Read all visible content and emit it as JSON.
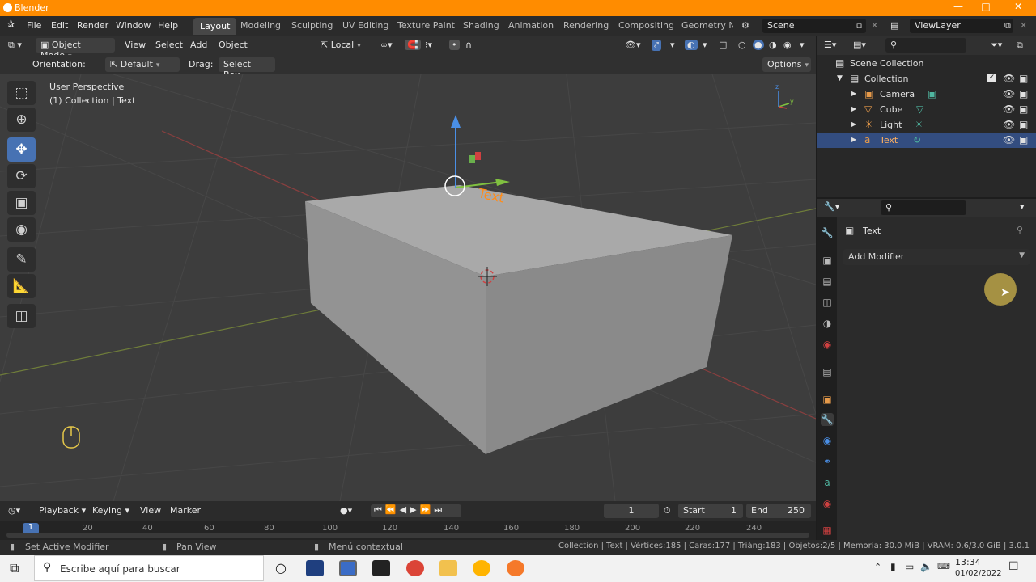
{
  "window": {
    "title": "Blender",
    "min_icon": "minimize-icon",
    "max_icon": "maximize-icon",
    "close_icon": "close-icon"
  },
  "menu": [
    "File",
    "Edit",
    "Render",
    "Window",
    "Help"
  ],
  "workspaces": [
    "Layout",
    "Modeling",
    "Sculpting",
    "UV Editing",
    "Texture Paint",
    "Shading",
    "Animation",
    "Rendering",
    "Compositing",
    "Geometry Nc"
  ],
  "scene": {
    "name": "Scene",
    "view_layer": "ViewLayer"
  },
  "viewport_header": {
    "mode": "Object Mode",
    "menus": [
      "View",
      "Select",
      "Add",
      "Object"
    ],
    "transform_orientation": "Local",
    "orientation_label": "Orientation:",
    "orientation_value": "Default",
    "drag_label": "Drag:",
    "drag_value": "Select Box",
    "options": "Options"
  },
  "viewport": {
    "perspective": "User Perspective",
    "context": "(1) Collection | Text"
  },
  "outliner": {
    "scene_collection": "Scene Collection",
    "collection": "Collection",
    "items": [
      {
        "label": "Camera",
        "icon": "camera-icon",
        "color": "#e69a4a"
      },
      {
        "label": "Cube",
        "icon": "mesh-icon",
        "color": "#e69a4a"
      },
      {
        "label": "Light",
        "icon": "light-icon",
        "color": "#e69a4a"
      },
      {
        "label": "Text",
        "icon": "text-icon",
        "color": "#e69a4a"
      }
    ]
  },
  "properties": {
    "object_name": "Text",
    "add_modifier": "Add Modifier"
  },
  "timeline": {
    "menus": [
      "Playback",
      "Keying",
      "View",
      "Marker"
    ],
    "current_frame": "1",
    "start_label": "Start",
    "start": "1",
    "end_label": "End",
    "end": "250",
    "ticks": [
      "1",
      "20",
      "40",
      "60",
      "80",
      "100",
      "120",
      "140",
      "160",
      "180",
      "200",
      "220",
      "240"
    ]
  },
  "statusbar": {
    "left1": "Set Active Modifier",
    "left2": "Pan View",
    "left3": "Menú contextual",
    "right": "Collection | Text | Vértices:185 | Caras:177 | Triáng:183 | Objetos:2/5 | Memoria: 30.0 MiB | VRAM: 0.6/3.0 GiB | 3.0.1"
  },
  "taskbar": {
    "search_placeholder": "Escribe aquí para buscar",
    "time": "13:34",
    "date": "01/02/2022"
  },
  "colors": {
    "accent": "#ff8c00",
    "active_tool": "#4772b3",
    "selected_row": "#334d80"
  }
}
